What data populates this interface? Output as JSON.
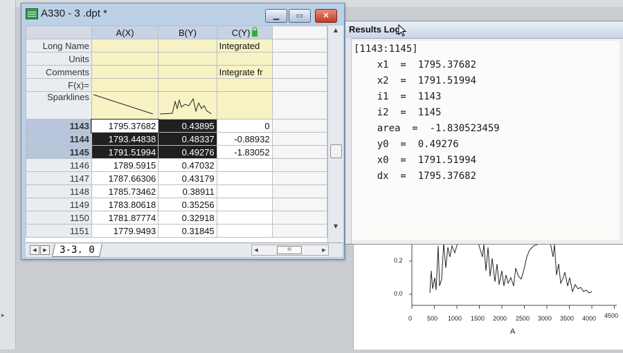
{
  "worksheet": {
    "title": "A330 - 3  .dpt *",
    "columns": [
      {
        "name": "A(X)"
      },
      {
        "name": "B(Y)"
      },
      {
        "name": "C(Y)"
      }
    ],
    "meta_rows": [
      {
        "label": "Long Name",
        "a": "",
        "b": "",
        "c": "Integrated"
      },
      {
        "label": "Units",
        "a": "",
        "b": "",
        "c": ""
      },
      {
        "label": "Comments",
        "a": "",
        "b": "",
        "c": "Integrate fr"
      },
      {
        "label": "F(x)=",
        "a": "",
        "b": "",
        "c": ""
      },
      {
        "label": "Sparklines",
        "a": "",
        "b": "",
        "c": ""
      }
    ],
    "rows": [
      {
        "idx": "1143",
        "a": "1795.37682",
        "b": "0.43895",
        "c": "0"
      },
      {
        "idx": "1144",
        "a": "1793.44838",
        "b": "0.48337",
        "c": "-0.88932"
      },
      {
        "idx": "1145",
        "a": "1791.51994",
        "b": "0.49276",
        "c": "-1.83052"
      },
      {
        "idx": "1146",
        "a": "1789.5915",
        "b": "0.47032",
        "c": ""
      },
      {
        "idx": "1147",
        "a": "1787.66306",
        "b": "0.43179",
        "c": ""
      },
      {
        "idx": "1148",
        "a": "1785.73462",
        "b": "0.38911",
        "c": ""
      },
      {
        "idx": "1149",
        "a": "1783.80618",
        "b": "0.35256",
        "c": ""
      },
      {
        "idx": "1150",
        "a": "1781.87774",
        "b": "0.32918",
        "c": ""
      },
      {
        "idx": "1151",
        "a": "1779.9493",
        "b": "0.31845",
        "c": ""
      }
    ],
    "sheet_tab": "3-3. 0",
    "hscroll_thumb": "III"
  },
  "results_log": {
    "title": "Results Log",
    "lines": [
      "[1143:1145]",
      "    x1  =  1795.37682",
      "    x2  =  1791.51994",
      "    i1  =  1143",
      "    i2  =  1145",
      "    area  =  -1.830523459",
      "    y0  =  0.49276",
      "    x0  =  1791.51994",
      "    dx  =  1795.37682"
    ]
  },
  "graph": {
    "y_ticks": [
      "0.2",
      "0.0"
    ],
    "x_ticks": [
      "0",
      "500",
      "1000",
      "1500",
      "2000",
      "2500",
      "3000",
      "3500",
      "4000",
      "4500"
    ],
    "x_label": "A"
  },
  "colors": {
    "selection": "#202020",
    "meta_fill": "#f7f3c4",
    "close_button": "#c23a22"
  }
}
